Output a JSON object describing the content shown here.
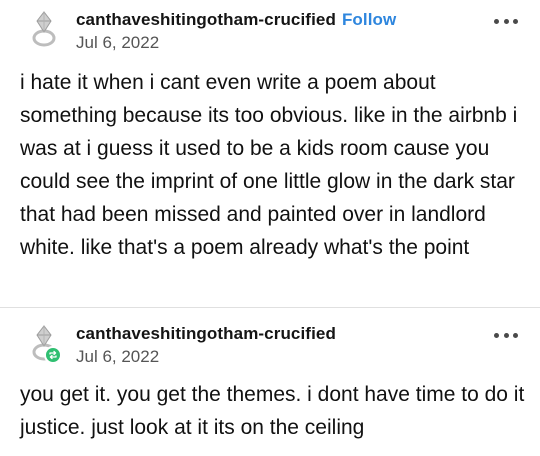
{
  "posts": [
    {
      "username": "canthaveshitingotham-crucified",
      "follow_label": "Follow",
      "date": "Jul 6, 2022",
      "body": "i hate it when i cant even write a poem about something because its too obvious. like in the airbnb i was at i guess it used to be a kids room cause you could see the imprint of one little glow in the dark star that had been missed and painted over in landlord white. like that's a poem already what's the point",
      "avatar_icon": "ring-avatar-icon",
      "menu_icon": "more-options-icon"
    },
    {
      "username": "canthaveshitingotham-crucified",
      "date": "Jul 6, 2022",
      "body": "you get it. you get the themes. i dont have time to do it justice. just look at it its on the ceiling",
      "avatar_icon": "ring-avatar-icon",
      "badge_icon": "reblog-icon",
      "badge_color": "#2fbf71",
      "menu_icon": "more-options-icon"
    }
  ],
  "colors": {
    "follow": "#2e86de",
    "text": "#111111",
    "muted": "#555555"
  }
}
